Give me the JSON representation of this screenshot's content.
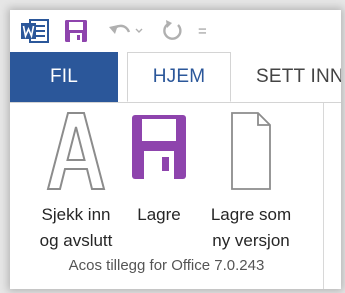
{
  "quick_access": {
    "app_icon": "word-icon",
    "save_icon": "save-icon",
    "undo_icon": "undo-icon",
    "redo_icon": "redo-icon",
    "customize_icon": "customize-arrow-icon",
    "customize_label": "="
  },
  "tabs": [
    {
      "label": "FIL"
    },
    {
      "label": "HJEM"
    },
    {
      "label": "SETT INN"
    }
  ],
  "ribbon": {
    "group_label": "Acos tillegg for Office 7.0.243",
    "buttons": [
      {
        "line1": "Sjekk inn",
        "line2": "og avslutt",
        "icon": "letter-a-icon"
      },
      {
        "line1": "Lagre",
        "line2": "",
        "icon": "floppy-disk-icon"
      },
      {
        "line1": "Lagre som",
        "line2": "ny versjon",
        "icon": "blank-document-icon"
      }
    ]
  },
  "colors": {
    "file_tab": "#2b579a",
    "active_tab_text": "#2b579a",
    "save_purple": "#8e44ad"
  }
}
